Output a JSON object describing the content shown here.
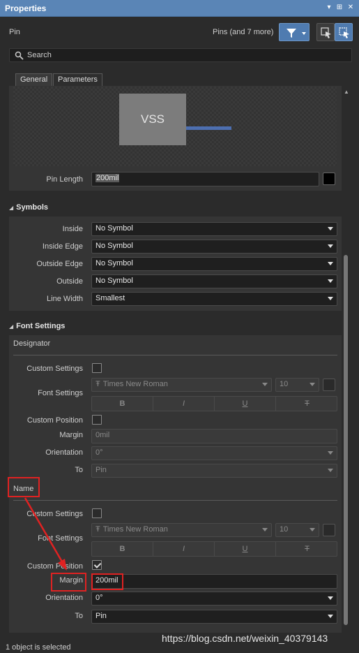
{
  "titlebar": {
    "title": "Properties"
  },
  "header": {
    "object_type": "Pin",
    "filter_text": "Pins (and 7 more)"
  },
  "search": {
    "placeholder": "Search"
  },
  "tabs": [
    "General",
    "Parameters"
  ],
  "preview": {
    "pin_name": "VSS"
  },
  "pin_length": {
    "label": "Pin Length",
    "value": "200mil"
  },
  "symbols": {
    "header": "Symbols",
    "rows": [
      {
        "label": "Inside",
        "value": "No Symbol"
      },
      {
        "label": "Inside Edge",
        "value": "No Symbol"
      },
      {
        "label": "Outside Edge",
        "value": "No Symbol"
      },
      {
        "label": "Outside",
        "value": "No Symbol"
      },
      {
        "label": "Line Width",
        "value": "Smallest"
      }
    ]
  },
  "font_settings": {
    "header": "Font Settings",
    "designator": {
      "title": "Designator",
      "custom_settings_label": "Custom Settings",
      "font_settings_label": "Font Settings",
      "font_name": "Times New Roman",
      "font_size": "10",
      "format_buttons": [
        "B",
        "I",
        "U",
        "T"
      ],
      "custom_position_label": "Custom Position",
      "margin_label": "Margin",
      "margin_value": "0mil",
      "orientation_label": "Orientation",
      "orientation_value": "0°",
      "to_label": "To",
      "to_value": "Pin"
    },
    "name": {
      "title": "Name",
      "custom_settings_label": "Custom Settings",
      "font_settings_label": "Font Settings",
      "font_name": "Times New Roman",
      "font_size": "10",
      "format_buttons": [
        "B",
        "I",
        "U",
        "T"
      ],
      "custom_position_label": "Custom Position",
      "margin_label": "Margin",
      "margin_value": "200mil",
      "orientation_label": "Orientation",
      "orientation_value": "0°",
      "to_label": "To",
      "to_value": "Pin"
    }
  },
  "status": {
    "text": "1 object is selected"
  },
  "watermark": {
    "text": "https://blog.csdn.net/weixin_40379143"
  },
  "colors": {
    "titlebar": "#5a85b6",
    "accent_button": "#4f7bb0",
    "annotation_red": "#e02222",
    "pin_line": "#4d6fb0"
  }
}
